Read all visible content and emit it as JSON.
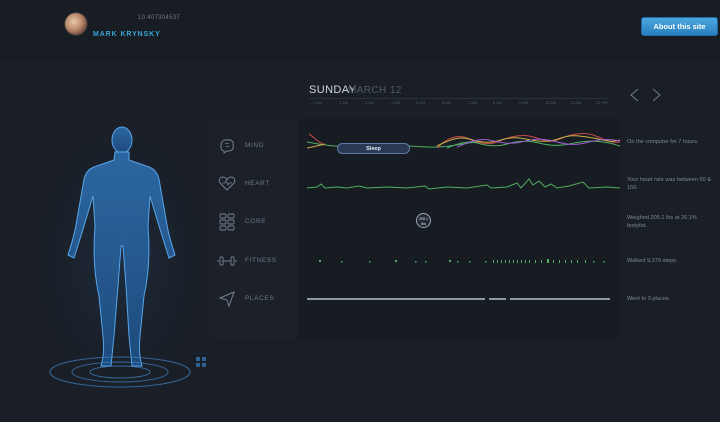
{
  "user": {
    "id": "10.407304537",
    "name": "MARK KRYNSKY"
  },
  "header": {
    "about_label": "About this site"
  },
  "timeline": {
    "day": "SUNDAY",
    "date": "MARCH 12",
    "ticks": [
      "1 AM",
      "2 AM",
      "3 AM",
      "4 AM",
      "5 AM",
      "6 AM",
      "7 AM",
      "8 AM",
      "9 AM",
      "10 AM",
      "11 AM",
      "12 PM"
    ]
  },
  "rows": [
    {
      "key": "mind",
      "label": "MIND",
      "icon": "brain-icon",
      "description": "On the computer for 7 hours."
    },
    {
      "key": "heart",
      "label": "HEART",
      "icon": "heart-icon",
      "description": "Your heart rate was between 50 & 150."
    },
    {
      "key": "core",
      "label": "CORE",
      "icon": "core-grid-icon",
      "description": "Weighed 205.1 lbs at 26.1% bodyfat."
    },
    {
      "key": "fitness",
      "label": "FITNESS",
      "icon": "dumbbell-icon",
      "description": "Walked 9,379 steps."
    },
    {
      "key": "places",
      "label": "PLACES",
      "icon": "location-arrow-icon",
      "description": "Went to 3 places."
    }
  ],
  "mind": {
    "sleep_label": "Sleep"
  },
  "core": {
    "weight_value": "205.1",
    "weight_unit": "lbs"
  },
  "colors": {
    "accent": "#3aa7d8",
    "body": "#3c8fd9",
    "button": "#3b95d3",
    "series_red": "#c74a4a",
    "series_yellow": "#c9b14a",
    "series_green": "#4fae63",
    "series_purple": "#9c5ad1"
  }
}
